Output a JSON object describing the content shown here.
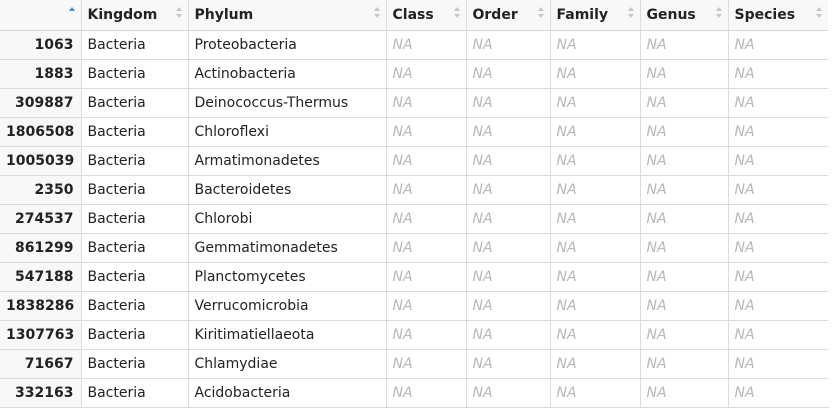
{
  "table": {
    "row_header_label": "",
    "columns": [
      "Kingdom",
      "Phylum",
      "Class",
      "Order",
      "Family",
      "Genus",
      "Species"
    ],
    "sorted_column": "row_names",
    "sort_direction": "ascending",
    "na_text": "NA",
    "rows": [
      {
        "id": "1063",
        "kingdom": "Bacteria",
        "phylum": "Proteobacteria",
        "class": "NA",
        "order": "NA",
        "family": "NA",
        "genus": "NA",
        "species": "NA"
      },
      {
        "id": "1883",
        "kingdom": "Bacteria",
        "phylum": "Actinobacteria",
        "class": "NA",
        "order": "NA",
        "family": "NA",
        "genus": "NA",
        "species": "NA"
      },
      {
        "id": "309887",
        "kingdom": "Bacteria",
        "phylum": "Deinococcus-Thermus",
        "class": "NA",
        "order": "NA",
        "family": "NA",
        "genus": "NA",
        "species": "NA"
      },
      {
        "id": "1806508",
        "kingdom": "Bacteria",
        "phylum": "Chloroflexi",
        "class": "NA",
        "order": "NA",
        "family": "NA",
        "genus": "NA",
        "species": "NA"
      },
      {
        "id": "1005039",
        "kingdom": "Bacteria",
        "phylum": "Armatimonadetes",
        "class": "NA",
        "order": "NA",
        "family": "NA",
        "genus": "NA",
        "species": "NA"
      },
      {
        "id": "2350",
        "kingdom": "Bacteria",
        "phylum": "Bacteroidetes",
        "class": "NA",
        "order": "NA",
        "family": "NA",
        "genus": "NA",
        "species": "NA"
      },
      {
        "id": "274537",
        "kingdom": "Bacteria",
        "phylum": "Chlorobi",
        "class": "NA",
        "order": "NA",
        "family": "NA",
        "genus": "NA",
        "species": "NA"
      },
      {
        "id": "861299",
        "kingdom": "Bacteria",
        "phylum": "Gemmatimonadetes",
        "class": "NA",
        "order": "NA",
        "family": "NA",
        "genus": "NA",
        "species": "NA"
      },
      {
        "id": "547188",
        "kingdom": "Bacteria",
        "phylum": "Planctomycetes",
        "class": "NA",
        "order": "NA",
        "family": "NA",
        "genus": "NA",
        "species": "NA"
      },
      {
        "id": "1838286",
        "kingdom": "Bacteria",
        "phylum": "Verrucomicrobia",
        "class": "NA",
        "order": "NA",
        "family": "NA",
        "genus": "NA",
        "species": "NA"
      },
      {
        "id": "1307763",
        "kingdom": "Bacteria",
        "phylum": "Kiritimatiellaeota",
        "class": "NA",
        "order": "NA",
        "family": "NA",
        "genus": "NA",
        "species": "NA"
      },
      {
        "id": "71667",
        "kingdom": "Bacteria",
        "phylum": "Chlamydiae",
        "class": "NA",
        "order": "NA",
        "family": "NA",
        "genus": "NA",
        "species": "NA"
      },
      {
        "id": "332163",
        "kingdom": "Bacteria",
        "phylum": "Acidobacteria",
        "class": "NA",
        "order": "NA",
        "family": "NA",
        "genus": "NA",
        "species": "NA"
      }
    ]
  },
  "colors": {
    "header_bg": "#f8f8f8",
    "grid_line": "#dcdcdc",
    "na_text": "#b8b8b8",
    "sort_active": "#3c8fd8",
    "sort_inactive": "#c6c6c6"
  },
  "icons": {
    "sort_ascending": "sort-ascending-icon",
    "sort_neutral": "sort-icon"
  }
}
